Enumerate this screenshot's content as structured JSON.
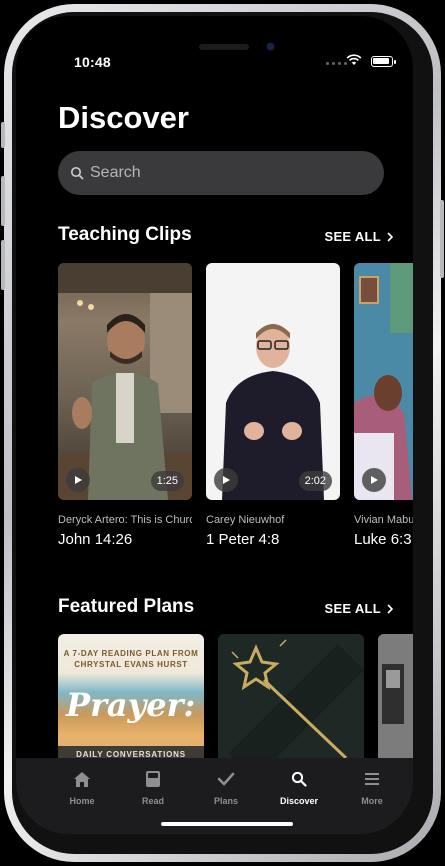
{
  "status_bar": {
    "time": "10:48"
  },
  "header": {
    "title": "Discover"
  },
  "search": {
    "placeholder": "Search"
  },
  "teaching_clips": {
    "title": "Teaching Clips",
    "see_all": "SEE ALL",
    "items": [
      {
        "speaker": "Deryck Artero: This is Churc",
        "reference": "John 14:26",
        "duration": "1:25"
      },
      {
        "speaker": "Carey Nieuwhof",
        "reference": "1 Peter 4:8",
        "duration": "2:02"
      },
      {
        "speaker": "Vivian Mabu",
        "reference": "Luke 6:3",
        "duration": ""
      }
    ]
  },
  "featured_plans": {
    "title": "Featured Plans",
    "see_all": "SEE ALL",
    "items": [
      {
        "top_text": "A 7-DAY READING PLAN FROM CHRYSTAL EVANS HURST",
        "script_title": "Prayer:",
        "bottom_text": "DAILY CONVERSATIONS"
      },
      {
        "top_text": "",
        "script_title": "",
        "bottom_text": ""
      },
      {
        "top_text": "",
        "script_title": "",
        "bottom_text": ""
      }
    ]
  },
  "tab_bar": {
    "tabs": [
      {
        "label": "Home",
        "icon": "home-icon"
      },
      {
        "label": "Read",
        "icon": "book-icon"
      },
      {
        "label": "Plans",
        "icon": "checkmark-icon"
      },
      {
        "label": "Discover",
        "icon": "search-icon",
        "active": true
      },
      {
        "label": "More",
        "icon": "menu-icon"
      }
    ]
  },
  "colors": {
    "background": "#000000",
    "search_bg": "#3a3a3c",
    "tabbar_bg": "#1c1c1e",
    "inactive_tab": "#8e8e93"
  }
}
